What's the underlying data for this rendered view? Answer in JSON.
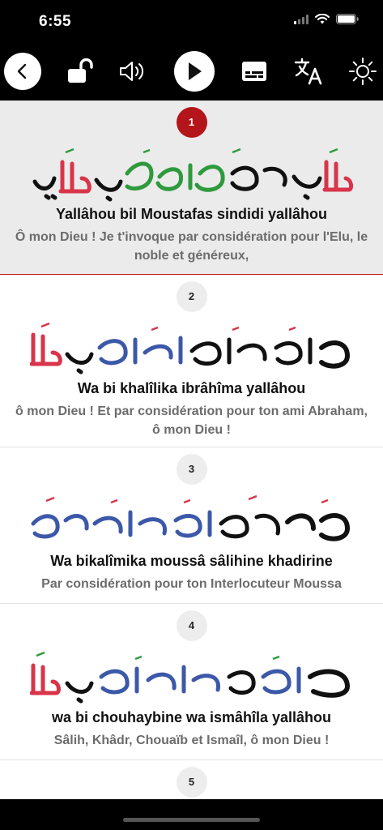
{
  "status": {
    "time": "6:55"
  },
  "colors": {
    "accent_red": "#b3151a",
    "green": "#2e9a3c",
    "blue": "#3c58a8",
    "black": "#111111"
  },
  "toolbar": {
    "icons": [
      "back-icon",
      "unlock-icon",
      "volume-icon",
      "play-icon",
      "subtitles-icon",
      "translate-icon",
      "brightness-icon"
    ]
  },
  "verses": [
    {
      "number": "1",
      "transliteration": "Yallâhou bil Moustafas sindidi yallâhou",
      "translation": "Ô mon Dieu ! Je t'invoque par considération pour l'Elu, le noble et généreux,"
    },
    {
      "number": "2",
      "transliteration": "Wa bi khalîlika ibrâhîma yallâhou",
      "translation": "ô mon Dieu ! Et par considération pour ton ami Abraham, ô mon Dieu !"
    },
    {
      "number": "3",
      "transliteration": "Wa bikalîmika moussâ sâlihine khadirine",
      "translation": "Par considération pour ton Interlocuteur Moussa"
    },
    {
      "number": "4",
      "transliteration": "wa bi chouhaybine wa ismâhîla yallâhou",
      "translation": "Sâlih, Khâdr, Chouaïb et Ismaîl, ô mon Dieu !"
    },
    {
      "number": "5"
    }
  ]
}
